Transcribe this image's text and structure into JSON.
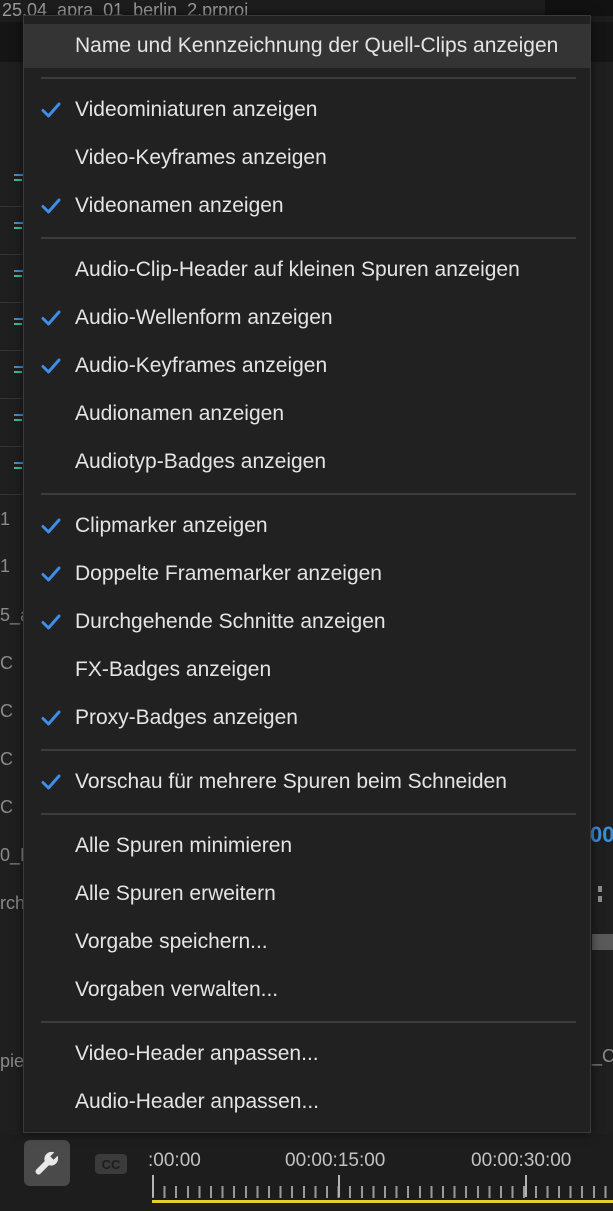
{
  "project": {
    "title": "25.04_apra_01_berlin_2.prproj"
  },
  "background": {
    "track_texts": [
      "1",
      "1",
      "5_a",
      "C",
      "C",
      "C",
      "C",
      "0_M",
      "rch",
      "pie"
    ],
    "right_label": "_C",
    "right_blue_text": "00"
  },
  "menu": {
    "items": [
      {
        "label": "Name und Kennzeichnung der Quell-Clips anzeigen",
        "checked": false,
        "hover": true
      },
      {
        "label": "Videominiaturen anzeigen",
        "checked": true
      },
      {
        "label": "Video-Keyframes anzeigen",
        "checked": false
      },
      {
        "label": "Videonamen anzeigen",
        "checked": true
      },
      {
        "label": "Audio-Clip-Header auf kleinen Spuren anzeigen",
        "checked": false
      },
      {
        "label": "Audio-Wellenform anzeigen",
        "checked": true
      },
      {
        "label": "Audio-Keyframes anzeigen",
        "checked": true
      },
      {
        "label": "Audionamen anzeigen",
        "checked": false
      },
      {
        "label": "Audiotyp-Badges anzeigen",
        "checked": false
      },
      {
        "label": "Clipmarker anzeigen",
        "checked": true
      },
      {
        "label": "Doppelte Framemarker anzeigen",
        "checked": true
      },
      {
        "label": "Durchgehende Schnitte anzeigen",
        "checked": true
      },
      {
        "label": "FX-Badges anzeigen",
        "checked": false
      },
      {
        "label": "Proxy-Badges anzeigen",
        "checked": true
      },
      {
        "label": "Vorschau für mehrere Spuren beim Schneiden",
        "checked": true
      },
      {
        "label": "Alle Spuren minimieren",
        "checked": false
      },
      {
        "label": "Alle Spuren erweitern",
        "checked": false
      },
      {
        "label": "Vorgabe speichern...",
        "checked": false
      },
      {
        "label": "Vorgaben verwalten...",
        "checked": false
      },
      {
        "label": "Video-Header anpassen...",
        "checked": false
      },
      {
        "label": "Audio-Header anpassen...",
        "checked": false
      }
    ]
  },
  "timeline": {
    "cc_label": "CC",
    "timecodes": [
      ":00:00",
      "00:00:15:00",
      "00:00:30:00"
    ]
  },
  "colors": {
    "check": "#3d8ee6",
    "menu_bg": "#212121",
    "hover_bg": "#343434",
    "playhead_line": "#e3cf28"
  }
}
